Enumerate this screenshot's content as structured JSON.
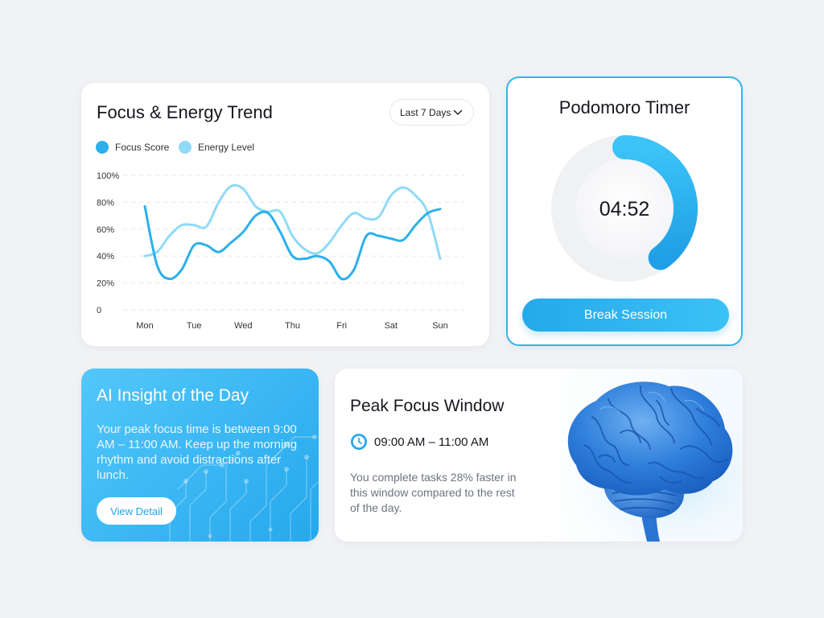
{
  "trend_card": {
    "title": "Focus & Energy Trend",
    "range": "Last 7 Days",
    "legend": [
      {
        "label": "Focus Score",
        "color": "#2bb0ec"
      },
      {
        "label": "Energy Level",
        "color": "#8fdaf7"
      }
    ]
  },
  "chart_data": {
    "type": "line",
    "categories": [
      "Mon",
      "Tue",
      "Wed",
      "Thu",
      "Fri",
      "Sat",
      "Sun"
    ],
    "y_ticks": [
      "0",
      "20%",
      "40%",
      "60%",
      "80%",
      "100%"
    ],
    "ylim": [
      0,
      100
    ],
    "grid": true,
    "legend_position": "top-left",
    "series": [
      {
        "name": "Focus Score",
        "color": "#2bb0ec",
        "x": [
          0,
          0.25,
          0.5,
          0.75,
          1,
          1.25,
          1.5,
          1.75,
          2,
          2.25,
          2.5,
          2.75,
          3,
          3.25,
          3.5,
          3.75,
          4,
          4.25,
          4.5,
          4.75,
          5,
          5.25,
          5.5,
          5.75,
          6
        ],
        "values": [
          77,
          33,
          23,
          30,
          48,
          48,
          43,
          50,
          58,
          70,
          72,
          58,
          40,
          38,
          40,
          36,
          23,
          30,
          55,
          55,
          53,
          52,
          63,
          72,
          75
        ]
      },
      {
        "name": "Energy Level",
        "color": "#8fdaf7",
        "x": [
          0,
          0.25,
          0.5,
          0.75,
          1,
          1.25,
          1.5,
          1.75,
          2,
          2.25,
          2.5,
          2.75,
          3,
          3.25,
          3.5,
          3.75,
          4,
          4.25,
          4.5,
          4.75,
          5,
          5.25,
          5.5,
          5.75,
          6
        ],
        "values": [
          40,
          43,
          55,
          63,
          63,
          62,
          80,
          92,
          90,
          77,
          73,
          73,
          55,
          45,
          42,
          50,
          63,
          72,
          68,
          69,
          85,
          91,
          85,
          72,
          38
        ]
      }
    ]
  },
  "timer_card": {
    "title": "Podomoro Timer",
    "time": "04:52",
    "progress": 0.4,
    "button": "Break Session"
  },
  "insight_card": {
    "title": "AI Insight of the Day",
    "body": "Your peak focus time is between 9:00 AM – 11:00 AM. Keep up the morning rhythm and avoid distractions after lunch.",
    "button": "View Detail"
  },
  "peak_card": {
    "title": "Peak Focus Window",
    "time": "09:00 AM – 11:00 AM",
    "description": "You complete tasks 28% faster in this window compared to the rest of the day.",
    "icons": {
      "time": "clock-icon",
      "illustration": "brain-icon"
    }
  },
  "colors": {
    "accent": "#2bb0ec",
    "accent_light": "#8fdaf7",
    "page_bg": "#f1f2f4"
  }
}
